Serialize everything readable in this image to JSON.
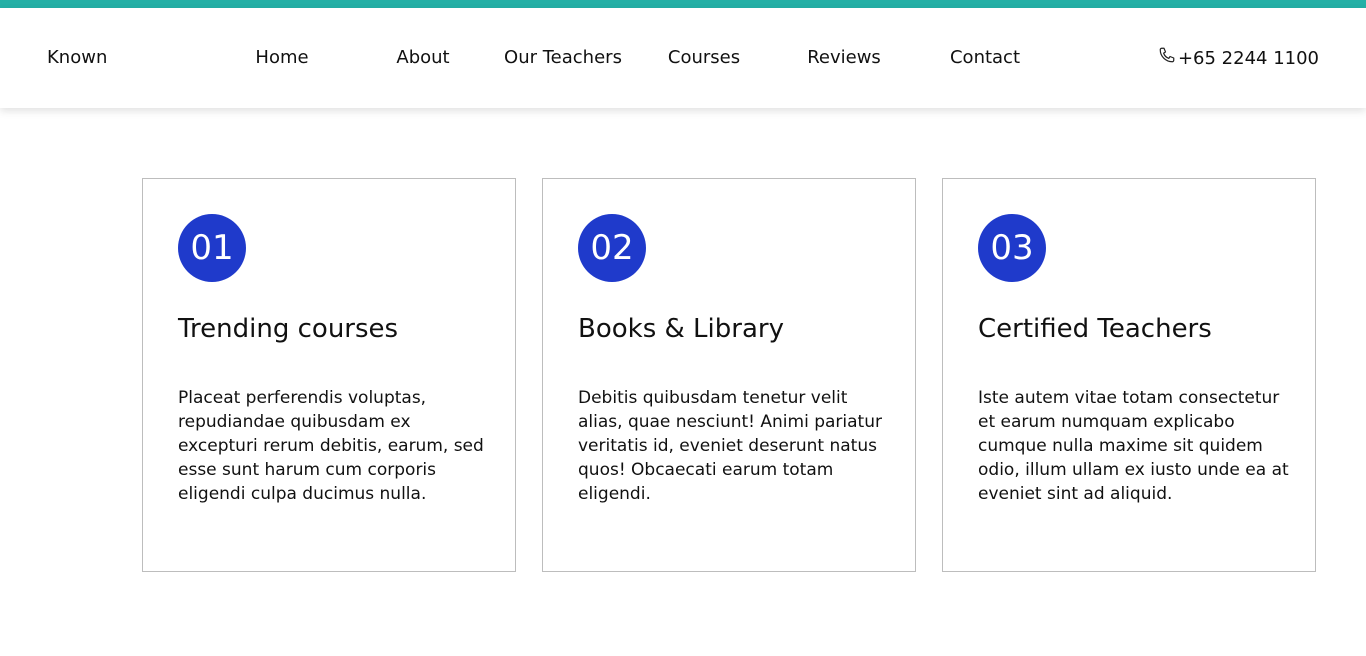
{
  "colors": {
    "accent_strip": "#24b0a6",
    "badge": "#1f3acb",
    "card_border": "#bdbdbd"
  },
  "header": {
    "brand": "Known",
    "nav": [
      "Home",
      "About",
      "Our Teachers",
      "Courses",
      "Reviews",
      "Contact"
    ],
    "phone_icon": "phone-icon",
    "phone": "+65 2244 1100"
  },
  "features": [
    {
      "number": "01",
      "title": "Trending courses",
      "text": "Placeat perferendis voluptas, repudiandae quibusdam ex excepturi rerum debitis, earum, sed esse sunt harum cum corporis eligendi culpa ducimus nulla."
    },
    {
      "number": "02",
      "title": "Books & Library",
      "text": "Debitis quibusdam tenetur velit alias, quae nesciunt! Animi pariatur veritatis id, eveniet deserunt natus quos! Obcaecati earum totam eligendi."
    },
    {
      "number": "03",
      "title": "Certified Teachers",
      "text": "Iste autem vitae totam consectetur et earum numquam explicabo cumque nulla maxime sit quidem odio, illum ullam ex iusto unde ea at eveniet sint ad aliquid."
    }
  ]
}
